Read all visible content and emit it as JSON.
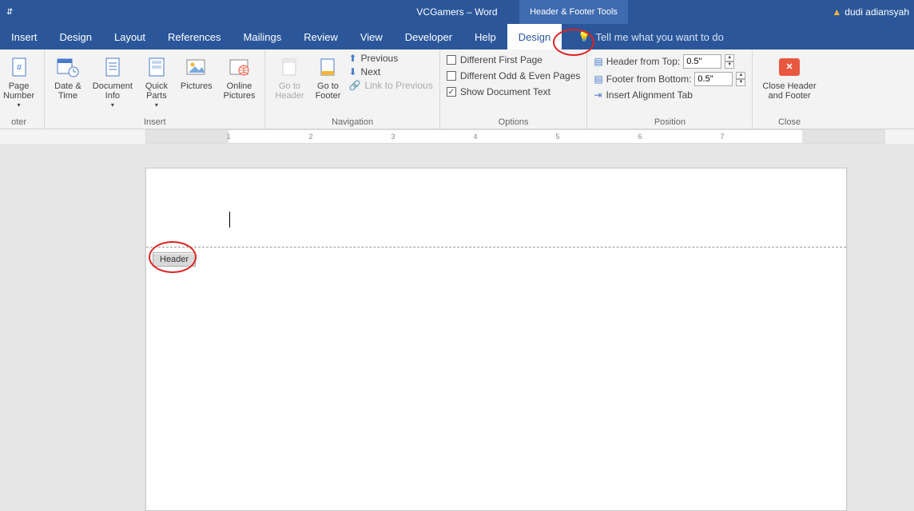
{
  "title": "VCGamers  –  Word",
  "contextual_tab": "Header & Footer Tools",
  "user": "dudi adiansyah",
  "tabs": [
    "Insert",
    "Design",
    "Layout",
    "References",
    "Mailings",
    "Review",
    "View",
    "Developer",
    "Help",
    "Design"
  ],
  "active_tab_index": 9,
  "tell_me": "Tell me what you want to do",
  "groups": {
    "headerfooter": {
      "label": "oter",
      "page_number": "Page\nNumber"
    },
    "insert": {
      "label": "Insert",
      "date_time": "Date &\nTime",
      "doc_info": "Document\nInfo",
      "quick_parts": "Quick\nParts",
      "pictures": "Pictures",
      "online_pictures": "Online\nPictures"
    },
    "navigation": {
      "label": "Navigation",
      "goto_header": "Go to\nHeader",
      "goto_footer": "Go to\nFooter",
      "previous": "Previous",
      "next": "Next",
      "link_prev": "Link to Previous"
    },
    "options": {
      "label": "Options",
      "diff_first": "Different First Page",
      "diff_odd_even": "Different Odd & Even Pages",
      "show_doc_text": "Show Document Text",
      "show_doc_text_checked": true
    },
    "position": {
      "label": "Position",
      "header_top": "Header from Top:",
      "footer_bottom": "Footer from Bottom:",
      "header_top_val": "0.5\"",
      "footer_bottom_val": "0.5\"",
      "insert_align": "Insert Alignment Tab"
    },
    "close": {
      "label": "Close",
      "close_hf": "Close Header\nand Footer"
    }
  },
  "ruler": {
    "min": 1,
    "max": 7,
    "margin_left": 1
  },
  "header_tag": "Header"
}
